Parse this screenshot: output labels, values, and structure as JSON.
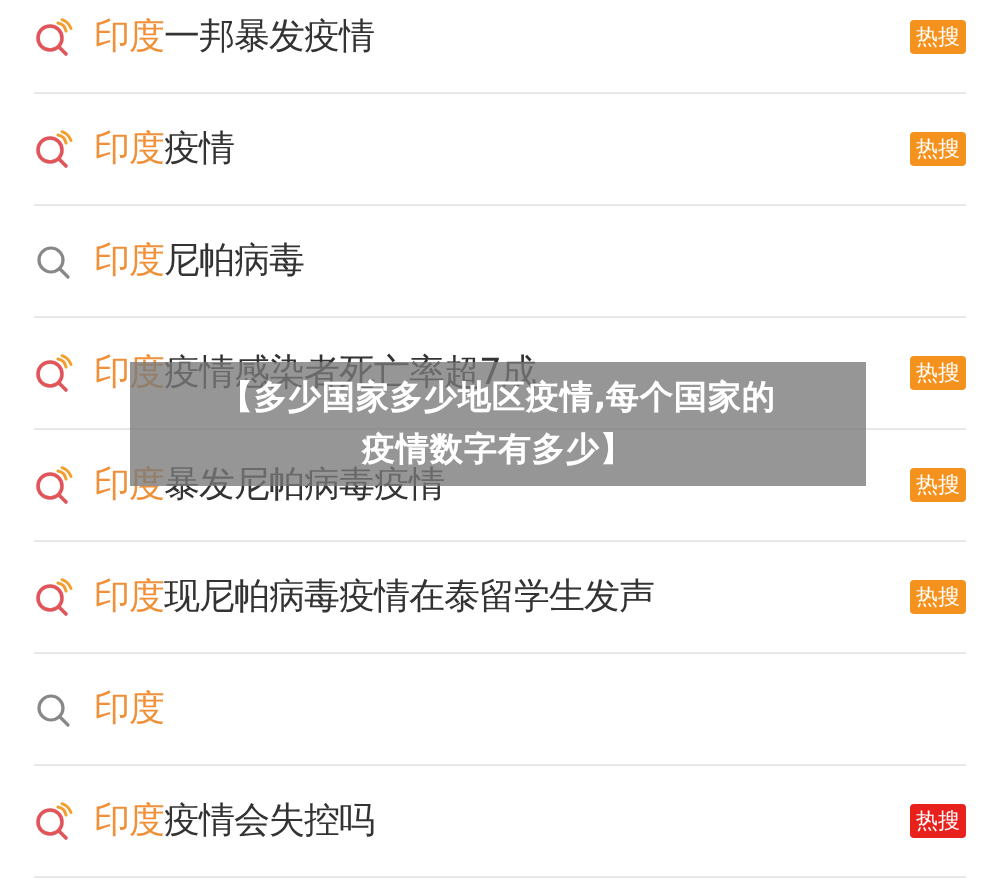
{
  "suggestions": [
    {
      "kind": "hot",
      "match": "印度",
      "rest": "一邦暴发疫情",
      "badge": {
        "text": "热搜",
        "color": "#f5921e"
      }
    },
    {
      "kind": "hot",
      "match": "印度",
      "rest": "疫情",
      "badge": {
        "text": "热搜",
        "color": "#f5921e"
      }
    },
    {
      "kind": "plain",
      "match": "印度",
      "rest": "尼帕病毒"
    },
    {
      "kind": "hot",
      "match": "印度",
      "rest": "疫情感染者死亡率超7成",
      "badge": {
        "text": "热搜",
        "color": "#f5921e"
      }
    },
    {
      "kind": "hot",
      "match": "印度",
      "rest": "暴发尼帕病毒疫情",
      "badge": {
        "text": "热搜",
        "color": "#f5921e"
      }
    },
    {
      "kind": "hot",
      "match": "印度",
      "rest": "现尼帕病毒疫情在泰留学生发声",
      "badge": {
        "text": "热搜",
        "color": "#f5921e"
      }
    },
    {
      "kind": "plain",
      "match": "印度"
    },
    {
      "kind": "hot",
      "match": "印度",
      "rest": "疫情会失控吗",
      "badge": {
        "text": "热搜",
        "color": "#e8211d"
      }
    }
  ],
  "caption": [
    "【多少国家多少地区疫情,每个国家的",
    "疫情数字有多少】"
  ]
}
